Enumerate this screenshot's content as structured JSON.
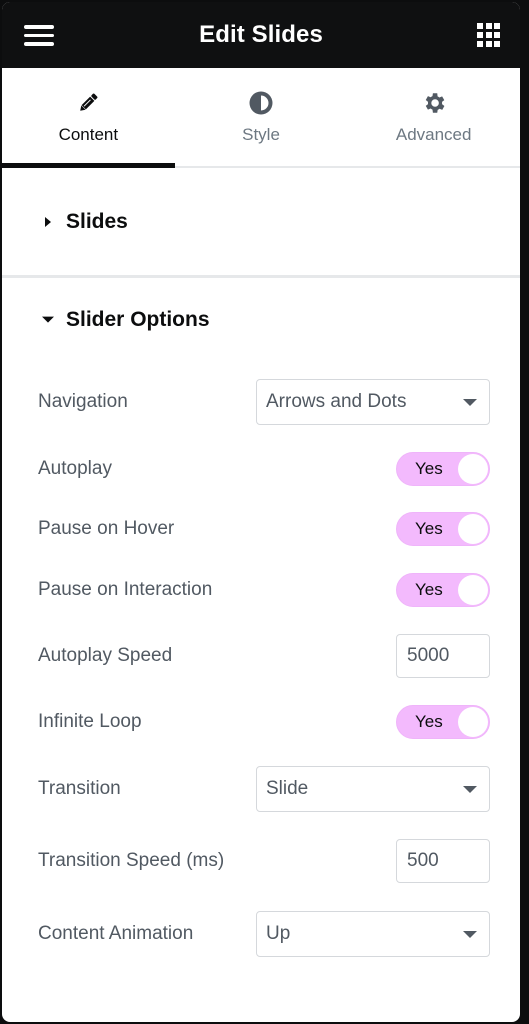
{
  "header": {
    "title": "Edit Slides",
    "menu_icon": "hamburger-icon",
    "apps_icon": "grid-icon"
  },
  "tabs": [
    {
      "label": "Content",
      "icon": "pencil-icon",
      "active": true
    },
    {
      "label": "Style",
      "icon": "half-circle-icon",
      "active": false
    },
    {
      "label": "Advanced",
      "icon": "gear-icon",
      "active": false
    }
  ],
  "sections": {
    "slides": {
      "title": "Slides",
      "expanded": false
    },
    "slider_options": {
      "title": "Slider Options",
      "expanded": true
    }
  },
  "controls": {
    "navigation": {
      "label": "Navigation",
      "value": "Arrows and Dots"
    },
    "autoplay": {
      "label": "Autoplay",
      "value": "Yes"
    },
    "pause_on_hover": {
      "label": "Pause on Hover",
      "value": "Yes"
    },
    "pause_on_interaction": {
      "label": "Pause on Interaction",
      "value": "Yes"
    },
    "autoplay_speed": {
      "label": "Autoplay Speed",
      "value": "5000"
    },
    "infinite_loop": {
      "label": "Infinite Loop",
      "value": "Yes"
    },
    "transition": {
      "label": "Transition",
      "value": "Slide"
    },
    "transition_speed": {
      "label": "Transition Speed (ms)",
      "value": "500"
    },
    "content_animation": {
      "label": "Content Animation",
      "value": "Up"
    }
  },
  "colors": {
    "header_bg": "#0f1011",
    "toggle_on": "#f3bafd",
    "label_text": "#515962",
    "border": "#d5d8dc"
  }
}
